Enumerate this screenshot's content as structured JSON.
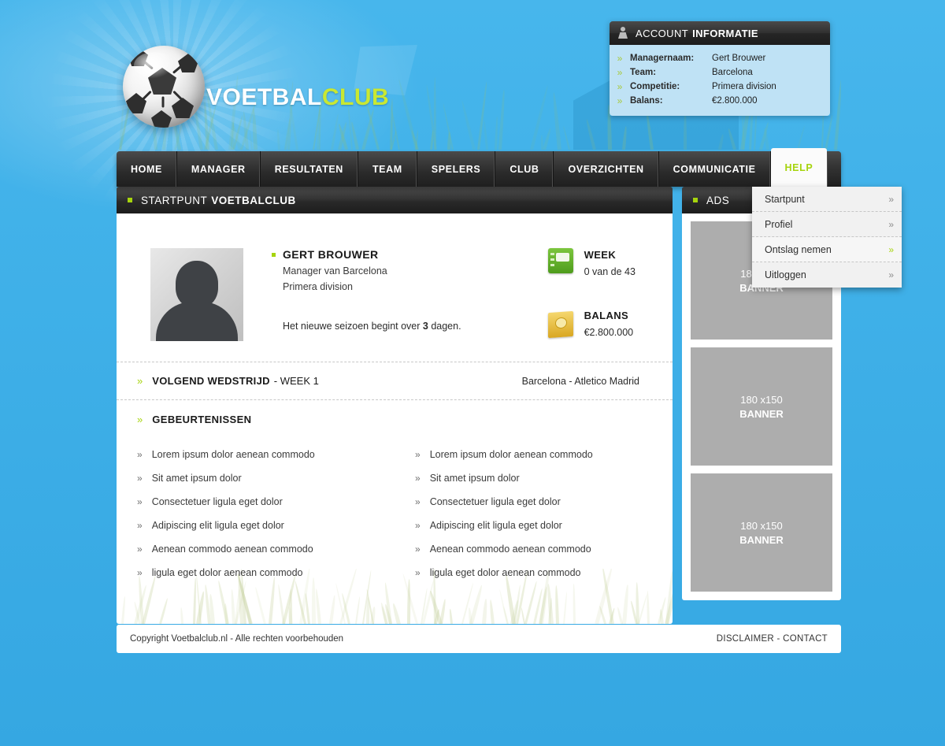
{
  "brand": {
    "name_part1": "VOETBAL",
    "name_part2": "CLUB",
    "accent_color": "#a6d40d",
    "sky_color": "#3fb0e8"
  },
  "account_panel": {
    "title_light": "ACCOUNT",
    "title_bold": "INFORMATIE",
    "icon": "user-icon",
    "rows": [
      {
        "bullet": "»",
        "label": "Managernaam:",
        "value": "Gert Brouwer"
      },
      {
        "bullet": "»",
        "label": "Team:",
        "value": "Barcelona"
      },
      {
        "bullet": "»",
        "label": "Competitie:",
        "value": "Primera division"
      },
      {
        "bullet": "»",
        "label": "Balans:",
        "value": "€2.800.000"
      }
    ]
  },
  "nav": {
    "items": [
      {
        "label": "HOME",
        "active": false
      },
      {
        "label": "MANAGER",
        "active": false
      },
      {
        "label": "RESULTATEN",
        "active": false
      },
      {
        "label": "TEAM",
        "active": false
      },
      {
        "label": "SPELERS",
        "active": false
      },
      {
        "label": "CLUB",
        "active": false
      },
      {
        "label": "OVERZICHTEN",
        "active": false
      },
      {
        "label": "COMMUNICATIE",
        "active": false
      },
      {
        "label": "HELP",
        "active": true
      }
    ]
  },
  "dropdown": {
    "open_for": "HELP",
    "items": [
      {
        "label": "Startpunt",
        "chevron": "»",
        "hover": false
      },
      {
        "label": "Profiel",
        "chevron": "»",
        "hover": false
      },
      {
        "label": "Ontslag nemen",
        "chevron": "»",
        "hover": true
      },
      {
        "label": "Uitloggen",
        "chevron": "»",
        "hover": false
      }
    ]
  },
  "content_panel": {
    "head_light": "STARTPUNT",
    "head_bold": "VOETBALCLUB",
    "profile": {
      "avatar_alt": "avatar-placeholder",
      "name": "GERT BROUWER",
      "role": "Manager van Barcelona",
      "league": "Primera division",
      "season_note_before": "Het nieuwe seizoen begint over ",
      "season_note_bold": "3",
      "season_note_after": " dagen."
    },
    "stats": [
      {
        "icon": "calendar-book-icon",
        "title": "WEEK",
        "value": "0 van de 43"
      },
      {
        "icon": "money-icon",
        "title": "BALANS",
        "value": "€2.800.000"
      }
    ],
    "match": {
      "chevron": "»",
      "title_bold": "VOLGEND WEDSTRIJD",
      "title_rest": "- WEEK 1",
      "fixture": "Barcelona - Atletico Madrid"
    },
    "events": {
      "chevron": "»",
      "heading": "GEBEURTENISSEN",
      "column_left": [
        "Lorem ipsum dolor aenean commodo",
        "Sit amet ipsum dolor",
        "Consectetuer ligula eget dolor",
        "Adipiscing elit ligula eget dolor",
        "Aenean commodo aenean commodo",
        "ligula eget dolor aenean commodo"
      ],
      "column_right": [
        "Lorem ipsum dolor aenean commodo",
        "Sit amet ipsum dolor",
        "Consectetuer ligula eget dolor",
        "Adipiscing elit ligula eget dolor",
        "Aenean commodo aenean commodo",
        "ligula eget dolor aenean commodo"
      ],
      "item_chevron": "»"
    }
  },
  "ads_panel": {
    "head": "ADS",
    "banners": [
      {
        "size": "180 x150",
        "label": "BANNER"
      },
      {
        "size": "180 x150",
        "label": "BANNER"
      },
      {
        "size": "180 x150",
        "label": "BANNER"
      }
    ]
  },
  "footer": {
    "copyright": "Copyright Voetbalclub.nl - Alle rechten voorbehouden",
    "disclaimer": "DISCLAIMER",
    "separator": "-",
    "contact": "CONTACT"
  }
}
